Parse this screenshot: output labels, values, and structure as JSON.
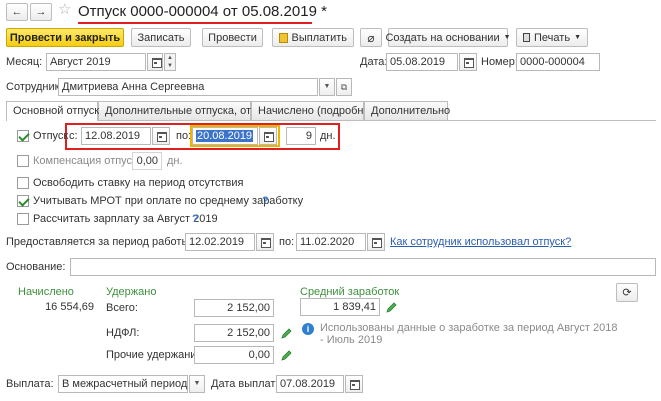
{
  "nav": {
    "back": "←",
    "forward": "→",
    "star": "☆"
  },
  "title": "Отпуск 0000-000004 от 05.08.2019 *",
  "toolbar": {
    "post_close": "Провести и закрыть",
    "save": "Записать",
    "post": "Провести",
    "pay": "Выплатить",
    "create_based": "Создать на основании",
    "print": "Печать"
  },
  "header": {
    "month_label": "Месяц:",
    "month_value": "Август 2019",
    "date_label": "Дата:",
    "date_value": "05.08.2019",
    "number_label": "Номер:",
    "number_value": "0000-000004",
    "employee_label": "Сотрудник:",
    "employee_value": "Дмитриева Анна Сергеевна"
  },
  "tabs": [
    {
      "label": "Основной отпуск",
      "active": true
    },
    {
      "label": "Дополнительные отпуска, отгулы",
      "active": false
    },
    {
      "label": "Начислено (подробно)",
      "active": false
    },
    {
      "label": "Дополнительно",
      "active": false
    }
  ],
  "leave": {
    "label": "Отпуск",
    "from_label": "с:",
    "from": "12.08.2019",
    "to_label": "по:",
    "to": "20.08.2019",
    "days": "9",
    "days_unit": "дн."
  },
  "compensation": {
    "label": "Компенсация отпуска",
    "value": "0,00",
    "unit": "дн."
  },
  "options": {
    "release_rate": "Освободить ставку на период отсутствия",
    "mrot": "Учитывать МРОТ при оплате по среднему заработку",
    "calc_salary": "Рассчитать зарплату за Август 2019"
  },
  "period": {
    "label": "Предоставляется за период работы с:",
    "from": "12.02.2019",
    "to_label": "по:",
    "to": "11.02.2020",
    "link": "Как сотрудник использовал отпуск?"
  },
  "basis": {
    "label": "Основание:",
    "value": ""
  },
  "totals": {
    "accrued_label": "Начислено",
    "accrued_value": "16 554,69",
    "withheld_label": "Удержано",
    "total_label": "Всего:",
    "total_value": "2 152,00",
    "ndfl_label": "НДФЛ:",
    "ndfl_value": "2 152,00",
    "other_label": "Прочие удержания:",
    "other_value": "0,00",
    "avg_label": "Средний заработок",
    "avg_value": "1 839,41",
    "info": "Использованы данные о заработке за период Август 2018 - Июль 2019"
  },
  "payout": {
    "label": "Выплата:",
    "value": "В межрасчетный период",
    "date_label": "Дата выплаты:",
    "date_value": "07.08.2019"
  },
  "colors": {
    "accent_red": "#e02020",
    "primary_yellow": "#f4cd12",
    "highlight_orange": "#f0b400",
    "label_green": "#3f8f3f"
  }
}
